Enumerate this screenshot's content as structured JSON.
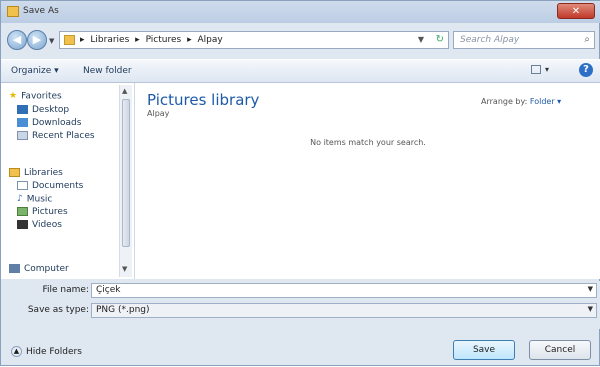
{
  "window": {
    "title": "Save As",
    "close_glyph": "✕"
  },
  "address": {
    "crumbs": [
      "Libraries",
      "Pictures",
      "Alpay"
    ],
    "separator": "▸",
    "search_placeholder": "Search Alpay"
  },
  "toolbar": {
    "organize": "Organize ▾",
    "new_folder": "New folder"
  },
  "nav": {
    "favorites": {
      "label": "Favorites",
      "items": [
        "Desktop",
        "Downloads",
        "Recent Places"
      ]
    },
    "libraries": {
      "label": "Libraries",
      "items": [
        "Documents",
        "Music",
        "Pictures",
        "Videos"
      ]
    },
    "computer": "Computer"
  },
  "content": {
    "title": "Pictures library",
    "subtitle": "Alpay",
    "arrange_label": "Arrange by:",
    "arrange_value": "Folder ▾",
    "empty_message": "No items match your search."
  },
  "form": {
    "file_name_label": "File name:",
    "file_name_value": "Çiçek",
    "save_type_label": "Save as type:",
    "save_type_value": "PNG (*.png)"
  },
  "footer": {
    "hide_folders": "Hide Folders",
    "save": "Save",
    "cancel": "Cancel"
  },
  "icons": {
    "back": "arrow-left-icon",
    "forward": "arrow-right-icon",
    "search": "search-icon",
    "help": "help-icon"
  }
}
